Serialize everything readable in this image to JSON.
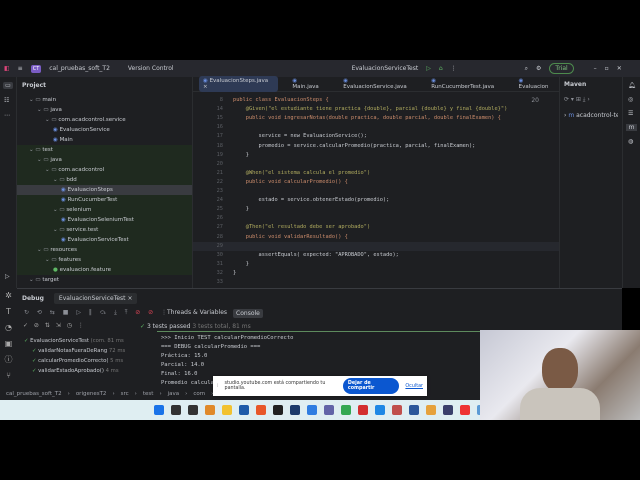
{
  "title": {
    "project": "cal_pruebas_soft_T2",
    "project_badge": "CT",
    "vcs": "Version Control",
    "run_config": "EvaluacionServiceTest",
    "trial": "Trial"
  },
  "project_panel": {
    "title": "Project",
    "items": [
      "main",
      "java",
      "com.acadcontrol.service",
      "EvaluacionService",
      "Main",
      "test",
      "java",
      "com.acadcontrol",
      "bdd",
      "EvaluacionSteps",
      "RunCucumberTest",
      "selenium",
      "EvaluacionSeleniumTest",
      "service.test",
      "EvaluacionServiceTest",
      "resources",
      "features",
      "evaluacion.feature",
      "target"
    ]
  },
  "editor": {
    "tabs": [
      "EvaluacionSteps.java",
      "Main.java",
      "EvaluacionService.java",
      "RunCucumberTest.java",
      "Evaluacion"
    ],
    "check_count": "20",
    "lines": [
      {
        "n": "8",
        "t": "public class EvaluacionSteps {"
      },
      {
        "n": "14",
        "t": "    @Given(\"el estudiante tiene practica {double}, parcial {double} y final {double}\")"
      },
      {
        "n": "15",
        "t": "    public void ingresarNotas(double practica, double parcial, double finalExamen) {"
      },
      {
        "n": "16",
        "t": ""
      },
      {
        "n": "17",
        "t": "        service = new EvaluacionService();"
      },
      {
        "n": "18",
        "t": "        promedio = service.calcularPromedio(practica, parcial, finalExamen);"
      },
      {
        "n": "19",
        "t": "    }"
      },
      {
        "n": "20",
        "t": ""
      },
      {
        "n": "21",
        "t": "    @When(\"el sistema calcula el promedio\")"
      },
      {
        "n": "22",
        "t": "    public void calcularPromedio() {"
      },
      {
        "n": "23",
        "t": ""
      },
      {
        "n": "24",
        "t": "        estado = service.obtenerEstado(promedio);"
      },
      {
        "n": "25",
        "t": "    }"
      },
      {
        "n": "26",
        "t": ""
      },
      {
        "n": "27",
        "t": "    @Then(\"el resultado debe ser aprobado\")"
      },
      {
        "n": "28",
        "t": "    public void validarResultado() {"
      },
      {
        "n": "29",
        "t": ""
      },
      {
        "n": "30",
        "t": "        assertEquals( expected: \"APROBADO\", estado);"
      },
      {
        "n": "31",
        "t": "    }"
      },
      {
        "n": "32",
        "t": "}"
      },
      {
        "n": "33",
        "t": ""
      }
    ]
  },
  "maven": {
    "title": "Maven",
    "item": "acadcontrol-tes"
  },
  "debug": {
    "title": "Debug",
    "session": "EvaluacionServiceTest",
    "tabs": [
      "Threads & Variables",
      "Console"
    ],
    "status": "3 tests passed",
    "status_detail": "3 tests total, 81 ms",
    "tests": [
      {
        "name": "EvaluacionServiceTest",
        "detail": "(com.",
        "time": "81 ms"
      },
      {
        "name": "validarNotasFueraDeRang",
        "time": "72 ms"
      },
      {
        "name": "calcularPromedioCorrecto(",
        "time": "5 ms"
      },
      {
        "name": "validarEstadoAprobado()",
        "time": "4 ms"
      }
    ],
    "console": [
      ">>> Inicio TEST calcularPromedioCorrecto",
      "=== DEBUG calcularPromedio ===",
      "Práctica: 15.0",
      "Parcial: 14.0",
      "Final: 16.0",
      "Promedio calculado:"
    ]
  },
  "breadcrumb": [
    "cal_pruebas_soft_T2",
    "origenesT2",
    "src",
    "test",
    "java",
    "com",
    "acado"
  ],
  "share": {
    "text": "studio.youtube.com está compartiendo tu pantalla.",
    "stop": "Dejar de compartir",
    "hide": "Ocultar"
  },
  "colors": {
    "accent": "#3574f0",
    "green": "#5d8a5d"
  }
}
